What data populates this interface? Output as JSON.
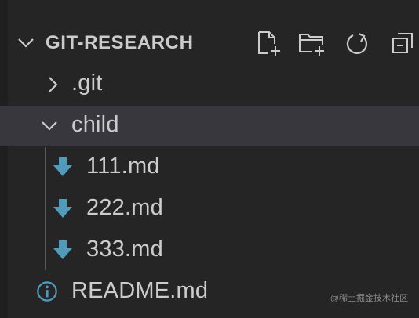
{
  "explorer": {
    "section_title": "GIT-RESEARCH",
    "actions": [
      {
        "name": "new-file-icon"
      },
      {
        "name": "new-folder-icon"
      },
      {
        "name": "refresh-icon"
      },
      {
        "name": "collapse-all-icon"
      }
    ],
    "items": [
      {
        "label": ".git",
        "type": "folder",
        "expanded": false
      },
      {
        "label": "child",
        "type": "folder",
        "expanded": true,
        "selected": true
      },
      {
        "label": "111.md",
        "type": "markdown-file"
      },
      {
        "label": "222.md",
        "type": "markdown-file"
      },
      {
        "label": "333.md",
        "type": "markdown-file"
      },
      {
        "label": "README.md",
        "type": "readme-file"
      }
    ]
  },
  "watermark": "@稀土掘金技术社区",
  "colors": {
    "background": "#252526",
    "selected_row": "#37373d",
    "text": "#cccccc",
    "markdown_icon": "#519aba",
    "info_icon": "#519aba"
  }
}
